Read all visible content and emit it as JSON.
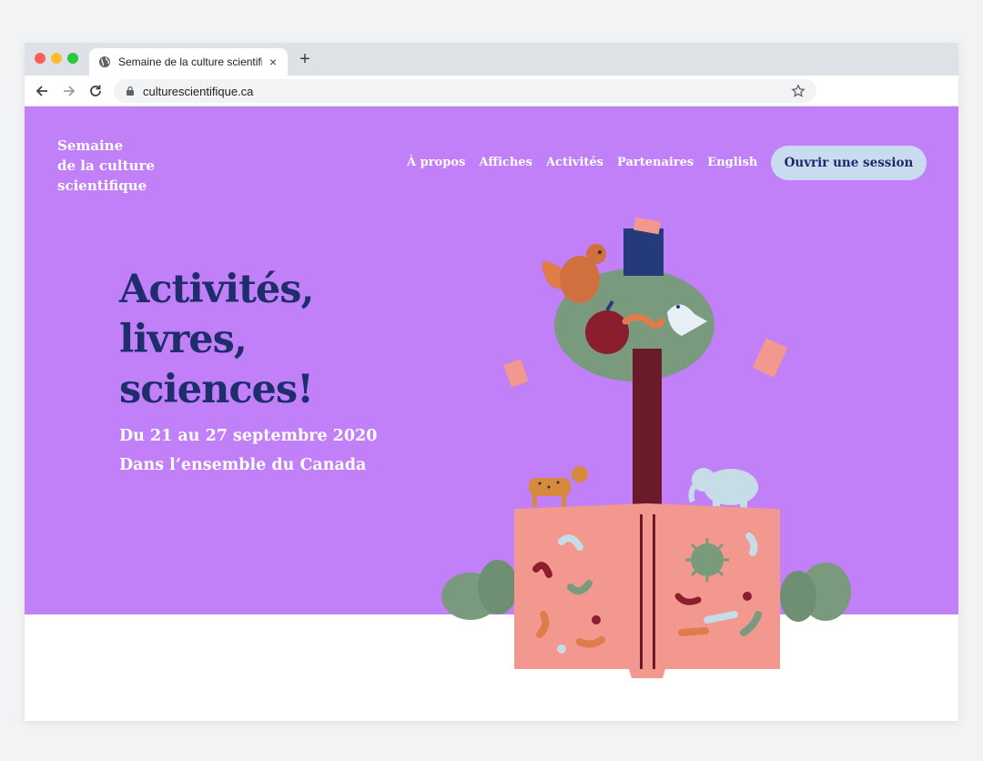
{
  "browser": {
    "tab_title": "Semaine de la culture scientifique",
    "tab_close": "×",
    "new_tab": "+",
    "url": "culturescientifique.ca"
  },
  "site": {
    "logo_lines": [
      "Semaine",
      "de la culture",
      "scientifique"
    ],
    "nav": [
      "À propos",
      "Affiches",
      "Activités",
      "Partenaires",
      "English"
    ],
    "signin_label": "Ouvrir une session"
  },
  "hero": {
    "headline_lines": [
      "Activités,",
      "livres,",
      "sciences!"
    ],
    "dates": "Du 21 au 27 septembre 2020",
    "location": "Dans l’ensemble du Canada"
  },
  "icons": {
    "tab": "globe-icon",
    "back": "back-arrow-icon",
    "forward": "forward-arrow-icon",
    "reload": "reload-icon",
    "lock": "lock-icon",
    "bookmark": "star-icon"
  },
  "colors": {
    "hero_bg": "#c17ff8",
    "headline": "#1e2d6b",
    "button_bg": "#c8dbef",
    "book": "#f2988f",
    "tree": "#7a9a7e",
    "trunk": "#6b1a2a"
  }
}
